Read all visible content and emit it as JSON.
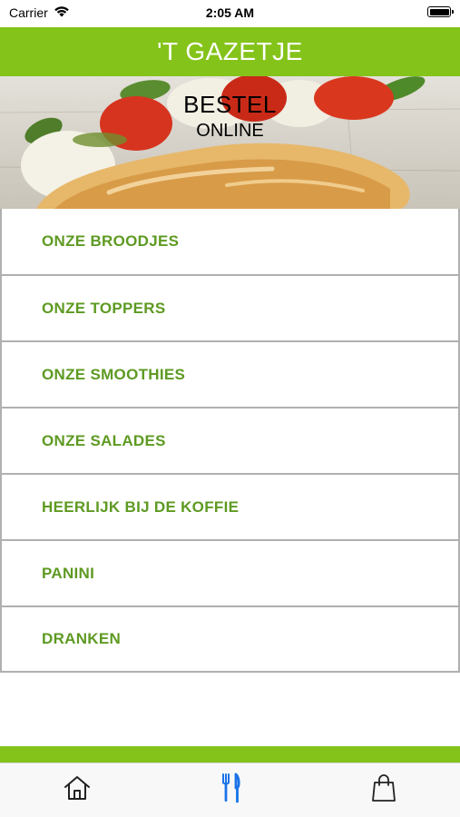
{
  "status_bar": {
    "carrier": "Carrier",
    "time": "2:05 AM",
    "icons": [
      "wifi-icon",
      "battery-icon"
    ]
  },
  "header": {
    "title": "'T GAZETJE",
    "color": "#84c31a"
  },
  "banner": {
    "line1": "BESTEL",
    "line2": "ONLINE"
  },
  "menu": {
    "text_color": "#5e9a22",
    "items": [
      {
        "label": "ONZE BROODJES"
      },
      {
        "label": "ONZE TOPPERS"
      },
      {
        "label": "ONZE SMOOTHIES"
      },
      {
        "label": "ONZE SALADES"
      },
      {
        "label": "HEERLIJK BIJ DE KOFFIE"
      },
      {
        "label": "PANINI"
      },
      {
        "label": "DRANKEN"
      }
    ]
  },
  "tab_bar": {
    "tabs": [
      {
        "icon": "home-icon",
        "active": false
      },
      {
        "icon": "fork-knife-icon",
        "active": true
      },
      {
        "icon": "shopping-bag-icon",
        "active": false
      }
    ],
    "active_color": "#1a73e8"
  }
}
